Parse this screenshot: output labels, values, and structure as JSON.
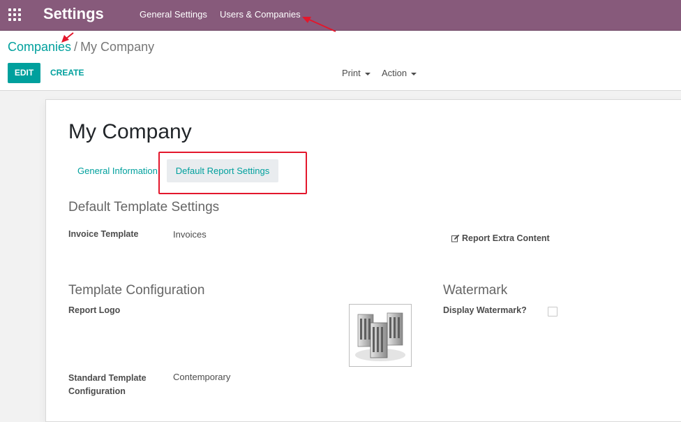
{
  "navbar": {
    "app_title": "Settings",
    "menu": [
      "General Settings",
      "Users & Companies"
    ]
  },
  "breadcrumb": {
    "parent": "Companies",
    "separator": "/",
    "current": "My Company"
  },
  "buttons": {
    "edit": "EDIT",
    "create": "CREATE",
    "print": "Print",
    "action": "Action"
  },
  "form": {
    "title": "My Company",
    "tabs": [
      "General Information",
      "Default Report Settings"
    ],
    "active_tab": "Default Report Settings",
    "default_template_settings": {
      "heading": "Default Template Settings",
      "invoice_template_label": "Invoice Template",
      "invoice_template_value": "Invoices",
      "report_extra_content": "Report Extra Content"
    },
    "template_configuration": {
      "heading": "Template Configuration",
      "report_logo_label": "Report Logo",
      "standard_template_label": "Standard Template Configuration",
      "standard_template_value": "Contemporary"
    },
    "watermark": {
      "heading": "Watermark",
      "display_watermark_label": "Display Watermark?",
      "display_watermark_checked": false
    }
  },
  "colors": {
    "navbar": "#875a7b",
    "accent": "#00a09d",
    "annotation": "#e3172c"
  }
}
